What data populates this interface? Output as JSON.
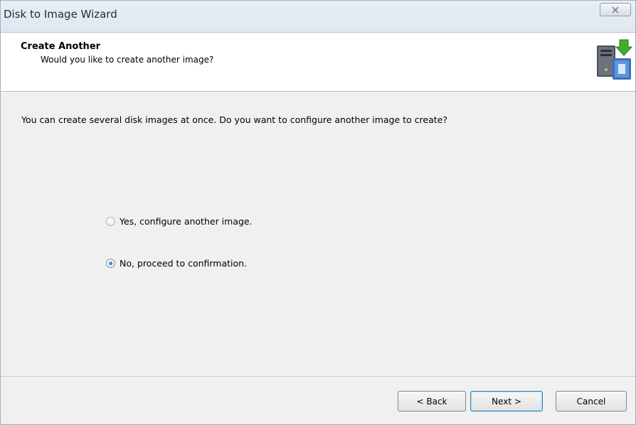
{
  "window": {
    "title": "Disk to Image Wizard"
  },
  "header": {
    "title": "Create Another",
    "subtitle": "Would you like to create another image?",
    "icon": "disk-image-computer-icon"
  },
  "body": {
    "intro": "You can create several disk images at once. Do you want to configure another image to create?",
    "options": [
      {
        "label": "Yes, configure another image.",
        "checked": false
      },
      {
        "label": "No, proceed to confirmation.",
        "checked": true
      }
    ]
  },
  "footer": {
    "back_label": "< Back",
    "next_label": "Next >",
    "cancel_label": "Cancel"
  }
}
